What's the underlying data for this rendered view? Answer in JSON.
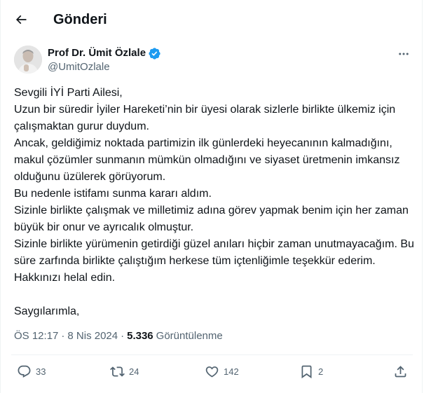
{
  "header": {
    "title": "Gönderi"
  },
  "author": {
    "name": "Prof Dr. Ümit Özlale",
    "handle": "@UmitOzlale",
    "verified": true
  },
  "post": {
    "lines": [
      "Sevgili İYİ Parti Ailesi,",
      "Uzun bir süredir İyiler Hareketi’nin bir üyesi olarak sizlerle birlikte ülkemiz için çalışmaktan gurur duydum.",
      "Ancak, geldiğimiz noktada partimizin ilk günlerdeki heyecanının kalmadığını, makul çözümler sunmanın mümkün olmadığını ve siyaset üretmenin imkansız olduğunu üzülerek görüyorum.",
      "Bu nedenle istifamı sunma kararı aldım.",
      "Sizinle birlikte çalışmak ve milletimiz adına görev yapmak benim için her zaman büyük bir onur ve ayrıcalık olmuştur.",
      "Sizinle birlikte yürümenin getirdiği güzel anıları hiçbir zaman unutmayacağım. Bu süre zarfında birlikte çalıştığım herkese tüm içtenliğimle teşekkür ederim. Hakkınızı helal edin."
    ],
    "signature": "Saygılarımla,"
  },
  "meta": {
    "time": "ÖS 12:17",
    "separator": "·",
    "date": "8 Nis 2024",
    "views_count": "5.336",
    "views_label": "Görüntülenme"
  },
  "actions": {
    "replies": "33",
    "reposts": "24",
    "likes": "142",
    "bookmarks": "2"
  },
  "colors": {
    "verified": "#1d9bf0",
    "secondary_text": "#536471",
    "primary_text": "#0f1419"
  }
}
